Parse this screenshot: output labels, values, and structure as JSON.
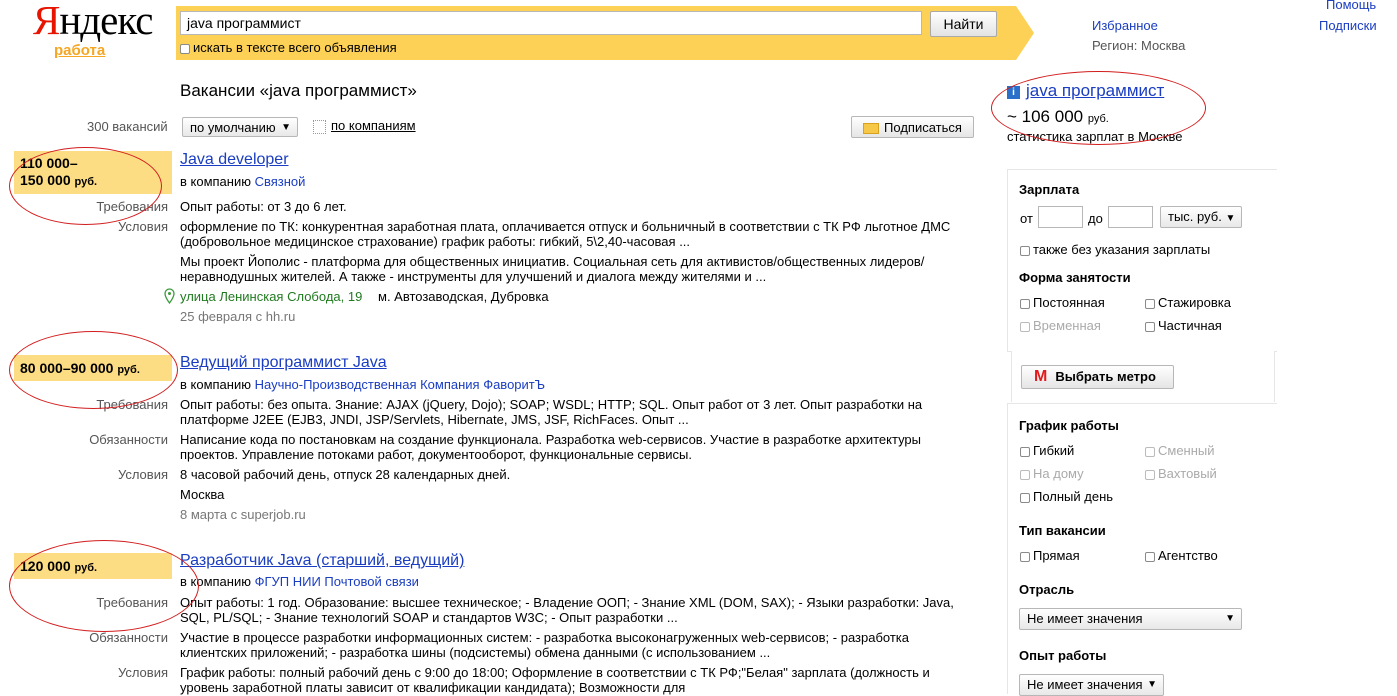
{
  "logo": {
    "name": "Яндекс",
    "name_first": "Я",
    "name_rest": "ндекс",
    "service": "работа"
  },
  "search": {
    "query": "java программист",
    "button": "Найти",
    "fulltext_label": "искать в тексте всего объявления"
  },
  "top_links": {
    "help": "Помощь",
    "subscriptions": "Подписки",
    "favorites": "Избранное",
    "region": "Регион: Москва"
  },
  "heading": "Вакансии «java программист»",
  "toolbar": {
    "count": "300 вакансий",
    "sort": "по умолчанию",
    "by_company": "по компаниям",
    "subscribe": "Подписаться"
  },
  "labels": {
    "requirements": "Требования",
    "conditions": "Условия",
    "duties": "Обязанности",
    "company_prefix": "в компанию"
  },
  "vacancies": [
    {
      "salary_line1": "110 000–",
      "salary_line2": "150 000",
      "currency": "руб.",
      "title": "Java developer",
      "company": "Связной",
      "requirements": "Опыт работы: от 3 до 6 лет.",
      "conditions1": "оформление по ТК: конкурентная заработная плата, оплачивается отпуск и больничный в соответствии с ТК РФ льготное ДМС",
      "conditions2": "(добровольное медицинское страхование) график работы: гибкий, 5\\2,40-часовая ...",
      "desc1": "Мы проект Йополис - платформа для общественных инициатив. Социальная сеть для активистов/общественных лидеров/",
      "desc2": "неравнодушных жителей. А также - инструменты для улучшений и диалога между жителями и ...",
      "address": "улица Ленинская Слобода, 19",
      "metro": "м. Автозаводская, Дубровка",
      "date": "25 февраля с hh.ru"
    },
    {
      "salary_line1": "80 000–90 000",
      "currency": "руб.",
      "title": "Ведущий программист Java",
      "company": "Научно-Производственная Компания ФаворитЪ",
      "requirements1": "Опыт работы: без опыта. Знание: AJAX (jQuery, Dojo); SOAP; WSDL; HTTP; SQL. Опыт работ от 3 лет. Опыт разработки на",
      "requirements2": "платформе J2EE (EJB3, JNDI, JSP/Servlets, Hibernate, JMS, JSF, RichFaces. Опыт ...",
      "duties1": "Написание кода по постановкам на создание функционала. Разработка web-сервисов. Участие в разработке архитектуры",
      "duties2": "проектов. Управление потоками работ, документооборот, функциональные сервисы.",
      "conditions": "8 часовой рабочий день, отпуск 28 календарных дней.",
      "city": "Москва",
      "date": "8 марта с superjob.ru"
    },
    {
      "salary_line1": "120 000",
      "currency": "руб.",
      "title": "Разработчик Java (старший, ведущий)",
      "company": "ФГУП НИИ Почтовой связи",
      "requirements1": "Опыт работы: 1 год. Образование: высшее техническое; - Владение ООП; - Знание XML (DOM, SAX); - Языки разработки: Java,",
      "requirements2": "SQL, PL/SQL; - Знание технологий SOAP и стандартов W3C; - Опыт разработки ...",
      "duties1": "Участие в процессе разработки информационных систем: - разработка высоконагруженных web-сервисов; - разработка",
      "duties2": "клиентских приложений; - разработка шины (подсистемы) обмена данными (с использованием ...",
      "conditions1": "График работы: полный рабочий день с 9:00 до 18:00; Оформление в соответствии с ТК РФ;\"Белая\" зарплата (должность и",
      "conditions2": "уровень заработной платы зависит от квалификации кандидата); Возможности для"
    }
  ],
  "stats": {
    "title": "java программист",
    "amount": "~ 106 000",
    "currency": "руб.",
    "caption": "статистика зарплат в Москве"
  },
  "filters": {
    "salary_title": "Зарплата",
    "from": "от",
    "to": "до",
    "unit": "тыс. руб.",
    "no_salary": "также без указания зарплаты",
    "employment_title": "Форма занятости",
    "employment": [
      "Постоянная",
      "Стажировка",
      "Временная",
      "Частичная"
    ],
    "metro_button": "Выбрать метро",
    "schedule_title": "График работы",
    "schedule": [
      "Гибкий",
      "Сменный",
      "На дому",
      "Вахтовый",
      "Полный день"
    ],
    "type_title": "Тип вакансии",
    "type": [
      "Прямая",
      "Агентство"
    ],
    "industry_title": "Отрасль",
    "industry_value": "Не имеет значения",
    "experience_title": "Опыт работы",
    "experience_value": "Не имеет значения"
  },
  "colors": {
    "accent": "#fdd056",
    "link": "#1a3dc1",
    "highlight_oval": "#d21d1d"
  }
}
